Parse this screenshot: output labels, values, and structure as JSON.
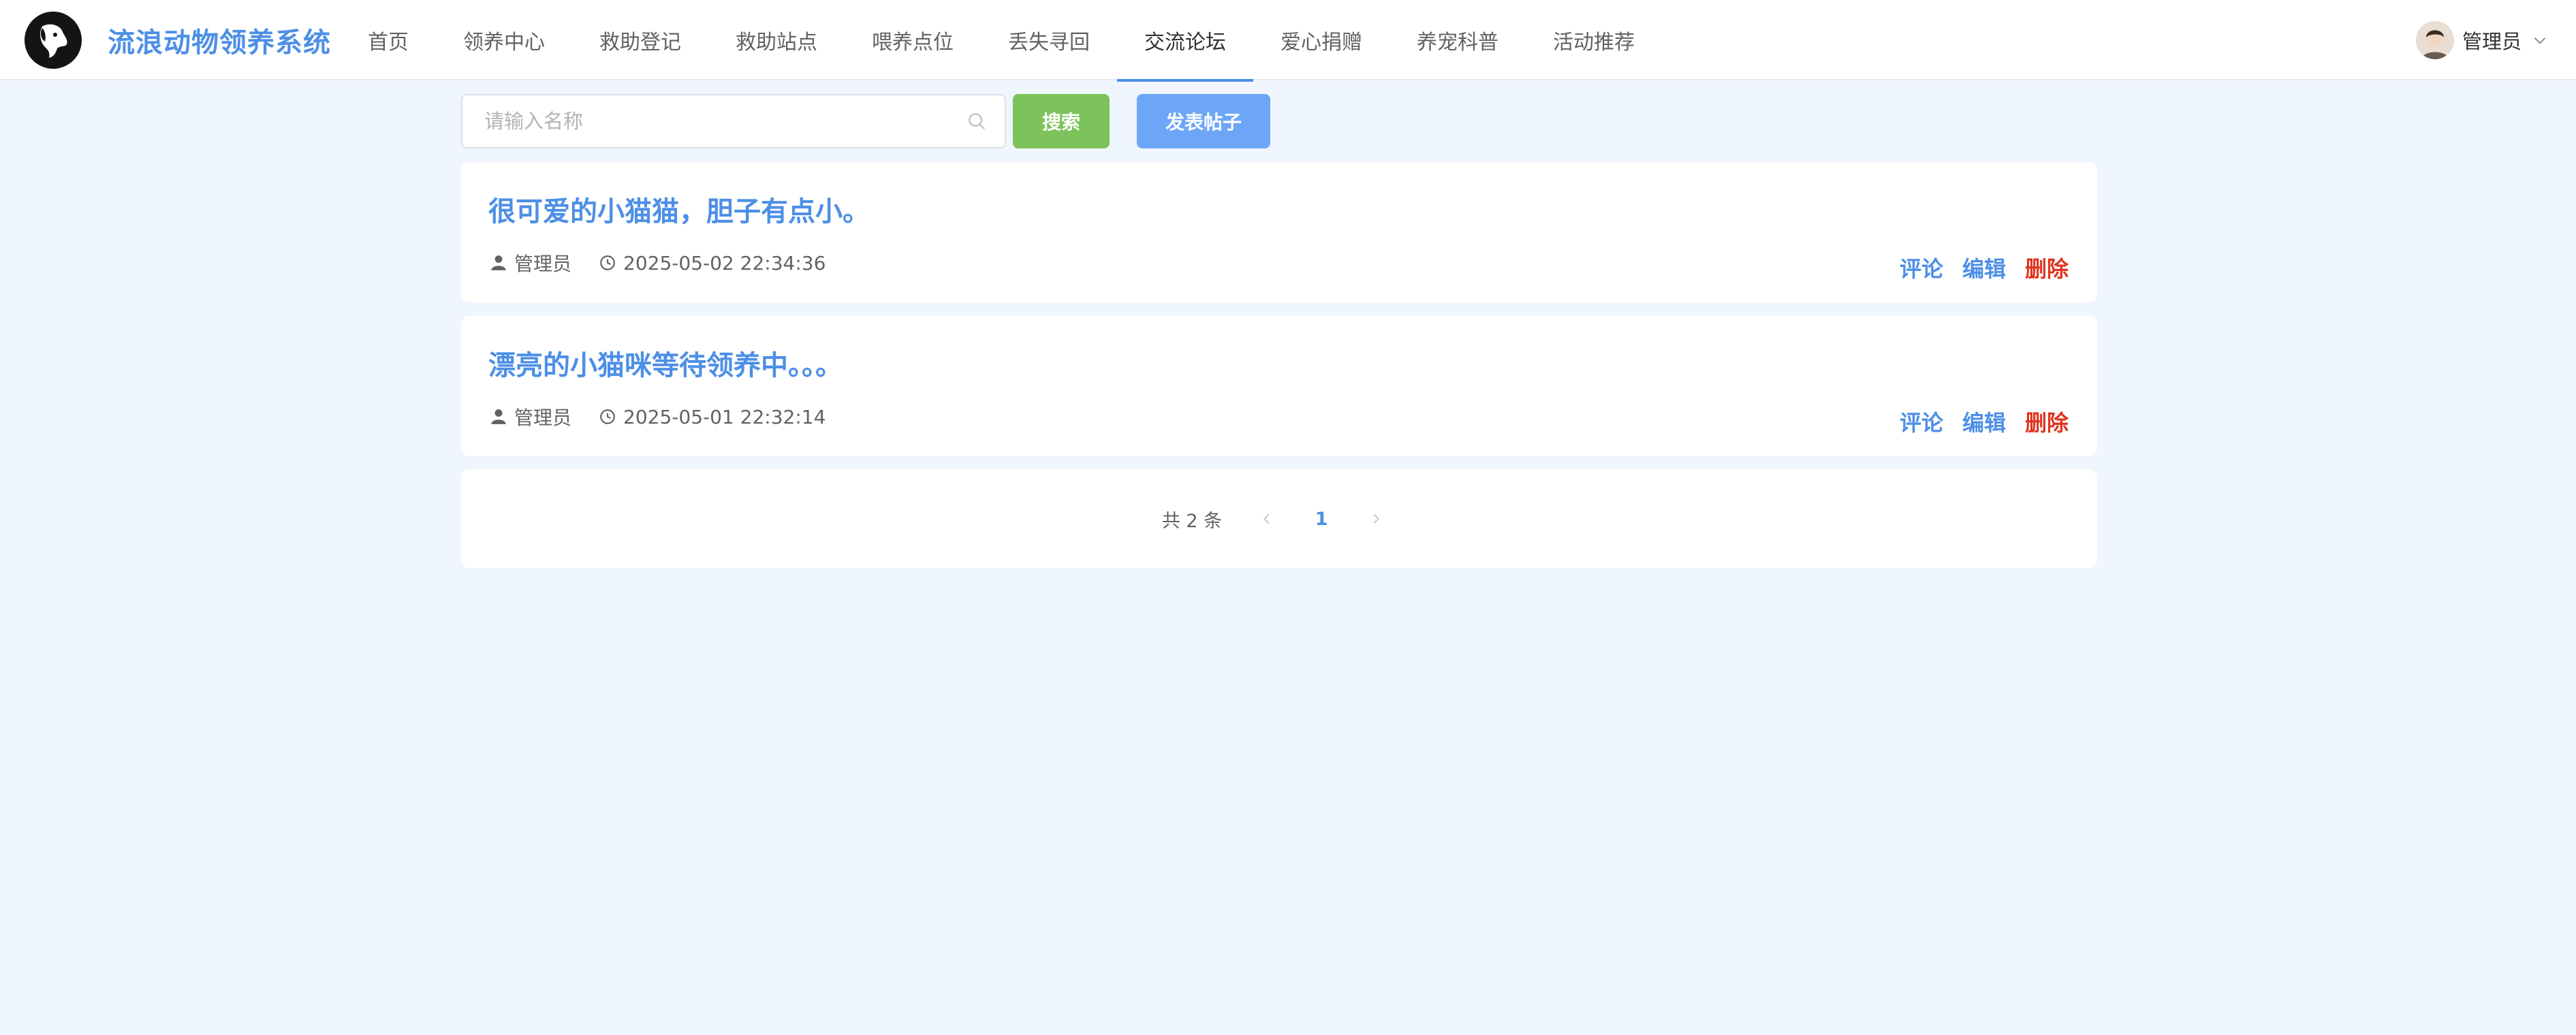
{
  "header": {
    "app_title": "流浪动物领养系统",
    "logo_icon": "dog-logo-icon",
    "nav": [
      {
        "label": "首页",
        "active": false
      },
      {
        "label": "领养中心",
        "active": false
      },
      {
        "label": "救助登记",
        "active": false
      },
      {
        "label": "救助站点",
        "active": false
      },
      {
        "label": "喂养点位",
        "active": false
      },
      {
        "label": "丢失寻回",
        "active": false
      },
      {
        "label": "交流论坛",
        "active": true
      },
      {
        "label": "爱心捐赠",
        "active": false
      },
      {
        "label": "养宠科普",
        "active": false
      },
      {
        "label": "活动推荐",
        "active": false
      }
    ],
    "user": {
      "name": "管理员"
    }
  },
  "toolbar": {
    "search_placeholder": "请输入名称",
    "search_value": "",
    "search_label": "搜索",
    "post_label": "发表帖子"
  },
  "posts": [
    {
      "title": "很可爱的小猫猫，胆子有点小。",
      "author": "管理员",
      "time": "2025-05-02 22:34:36",
      "comment_label": "评论",
      "edit_label": "编辑",
      "delete_label": "删除"
    },
    {
      "title": "漂亮的小猫咪等待领养中。。。",
      "author": "管理员",
      "time": "2025-05-01 22:32:14",
      "comment_label": "评论",
      "edit_label": "编辑",
      "delete_label": "删除"
    }
  ],
  "pagination": {
    "total_text": "共 2 条",
    "current_page": "1"
  },
  "colors": {
    "accent": "#4d8fe6",
    "search_button": "#7dc35b",
    "post_button": "#6ea6f7",
    "danger": "#e0341f",
    "background": "#f0f6fd"
  }
}
